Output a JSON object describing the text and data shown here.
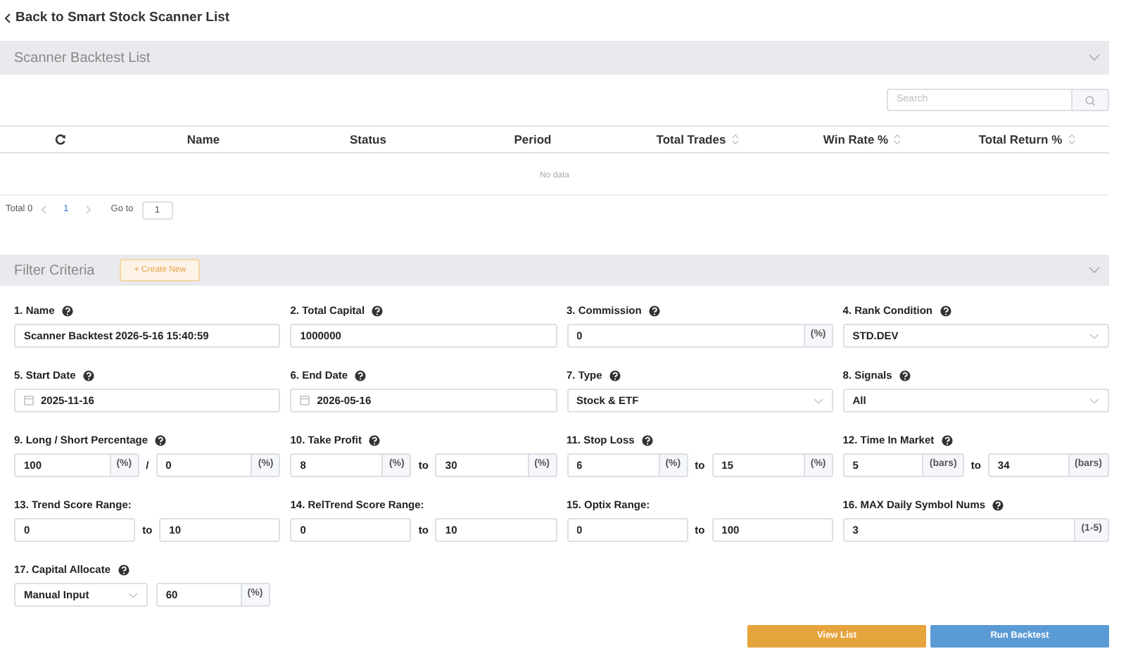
{
  "back_link": "Back to Smart Stock Scanner List",
  "backtest_panel": {
    "title": "Scanner Backtest List",
    "expanded": true,
    "search": {
      "placeholder": "Search"
    },
    "table": {
      "columns": [
        {
          "label": "Name",
          "sortable": false
        },
        {
          "label": "Status",
          "sortable": false
        },
        {
          "label": "Period",
          "sortable": false
        },
        {
          "label": "Total Trades",
          "sortable": true
        },
        {
          "label": "Win Rate %",
          "sortable": true
        },
        {
          "label": "Total Return %",
          "sortable": true
        }
      ],
      "empty_text": "No data"
    },
    "pagination": {
      "total": "Total 0",
      "pages": [
        {
          "label": "1",
          "selected": true
        }
      ],
      "goto_label": "Go to",
      "goto_value": "1"
    }
  },
  "filter_panel": {
    "title": "Filter Criteria",
    "expanded": true,
    "create_button": "+ Create New",
    "fields": [
      {
        "label": "1. Name",
        "help": true,
        "kind": "text",
        "value": "Scanner Backtest 2026-5-16 15:40:59"
      },
      {
        "label": "2. Total Capital",
        "help": true,
        "kind": "text",
        "value": "1000000"
      },
      {
        "label": "3. Commission",
        "help": true,
        "kind": "text",
        "value": "0",
        "suffix": "(%)"
      },
      {
        "label": "4. Rank Condition",
        "help": true,
        "kind": "select",
        "value": "STD.DEV"
      },
      {
        "label": "5. Start Date",
        "help": true,
        "kind": "date",
        "value": "2025-11-16"
      },
      {
        "label": "6. End Date",
        "help": true,
        "kind": "date",
        "value": "2026-05-16"
      },
      {
        "label": "7. Type",
        "help": true,
        "kind": "select",
        "value": "Stock & ETF"
      },
      {
        "label": "8. Signals",
        "help": true,
        "kind": "select",
        "value": "All"
      },
      {
        "label": "9. Long / Short Percentage",
        "help": true,
        "kind": "range",
        "from": {
          "value": "100",
          "suffix": "(%)"
        },
        "separator": "/",
        "to": {
          "value": "0",
          "suffix": "(%)"
        }
      },
      {
        "label": "10. Take Profit",
        "help": true,
        "kind": "range",
        "from": {
          "value": "8",
          "suffix": "(%)"
        },
        "separator": "to",
        "to": {
          "value": "30",
          "suffix": "(%)"
        }
      },
      {
        "label": "11. Stop Loss",
        "help": true,
        "kind": "range",
        "from": {
          "value": "6",
          "suffix": "(%)"
        },
        "separator": "to",
        "to": {
          "value": "15",
          "suffix": "(%)"
        }
      },
      {
        "label": "12. Time In Market",
        "help": true,
        "kind": "range",
        "from": {
          "value": "5",
          "suffix": "(bars)"
        },
        "separator": "to",
        "to": {
          "value": "34",
          "suffix": "(bars)"
        }
      },
      {
        "label": "13. Trend Score Range:",
        "help": false,
        "kind": "range",
        "from": {
          "value": "0"
        },
        "separator": "to",
        "to": {
          "value": "10"
        }
      },
      {
        "label": "14. RelTrend Score Range:",
        "help": false,
        "kind": "range",
        "from": {
          "value": "0"
        },
        "separator": "to",
        "to": {
          "value": "10"
        }
      },
      {
        "label": "15. Optix Range:",
        "help": false,
        "kind": "range",
        "from": {
          "value": "0"
        },
        "separator": "to",
        "to": {
          "value": "100"
        }
      },
      {
        "label": "16. MAX Daily Symbol Nums",
        "help": true,
        "kind": "text",
        "value": "3",
        "suffix": "(1-5)"
      },
      {
        "label": "17. Capital Allocate",
        "help": true,
        "kind": "select_input",
        "select": "Manual Input",
        "value": "60",
        "suffix": "(%)"
      }
    ],
    "buttons": [
      {
        "label": "View List",
        "kind": "secondary"
      },
      {
        "label": "Run Backtest",
        "kind": "primary"
      }
    ]
  }
}
